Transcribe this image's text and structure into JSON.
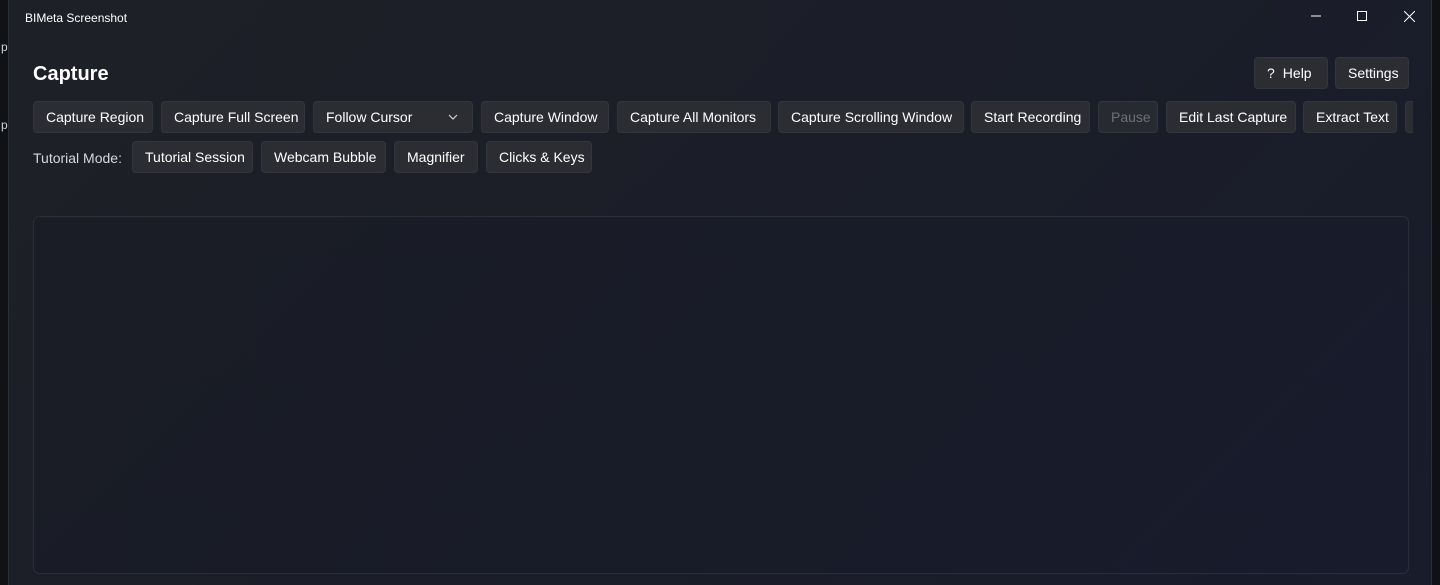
{
  "window": {
    "title": "BIMeta Screenshot"
  },
  "header": {
    "title": "Capture",
    "help_label": "Help",
    "settings_label": "Settings"
  },
  "toolbar": {
    "capture_region": "Capture Region",
    "capture_full_screen": "Capture Full Screen",
    "follow_cursor": "Follow Cursor",
    "capture_window": "Capture Window",
    "capture_all_monitors": "Capture All Monitors",
    "capture_scrolling_window": "Capture Scrolling Window",
    "start_recording": "Start Recording",
    "pause": "Pause",
    "edit_last_capture": "Edit Last Capture",
    "extract_text": "Extract Text"
  },
  "tutorial": {
    "label": "Tutorial Mode:",
    "session": "Tutorial Session",
    "webcam_bubble": "Webcam Bubble",
    "magnifier": "Magnifier",
    "clicks_keys": "Clicks & Keys"
  },
  "desktop": {
    "edge_glyph_1": "p",
    "edge_glyph_2": "p"
  },
  "icons": {
    "minimize": "minimize-icon",
    "maximize": "maximize-icon",
    "close": "close-icon",
    "help": "question-mark-icon",
    "dropdown": "chevron-down-icon"
  }
}
